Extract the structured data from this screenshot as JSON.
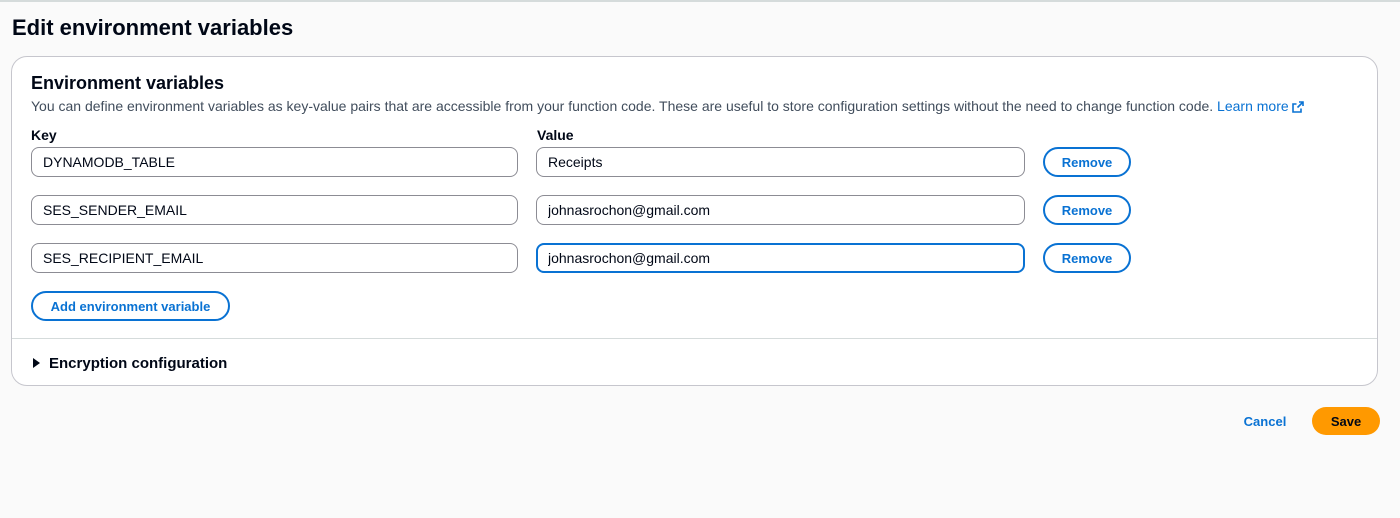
{
  "page": {
    "title": "Edit environment variables"
  },
  "panel": {
    "heading": "Environment variables",
    "description": "You can define environment variables as key-value pairs that are accessible from your function code. These are useful to store configuration settings without the need to change function code.",
    "learn_more": "Learn more",
    "key_label": "Key",
    "value_label": "Value",
    "rows": [
      {
        "key": "DYNAMODB_TABLE",
        "value": "Receipts",
        "remove_label": "Remove"
      },
      {
        "key": "SES_SENDER_EMAIL",
        "value": "johnasrochon@gmail.com",
        "remove_label": "Remove"
      },
      {
        "key": "SES_RECIPIENT_EMAIL",
        "value": "johnasrochon@gmail.com",
        "remove_label": "Remove"
      }
    ],
    "add_label": "Add environment variable",
    "encryption_label": "Encryption configuration"
  },
  "footer": {
    "cancel_label": "Cancel",
    "save_label": "Save"
  },
  "colors": {
    "accent": "#0972d3",
    "primary_button": "#ff9900",
    "text": "#000716"
  },
  "icons": {
    "external_link": "external-link-icon",
    "expand": "caret-right-icon"
  }
}
